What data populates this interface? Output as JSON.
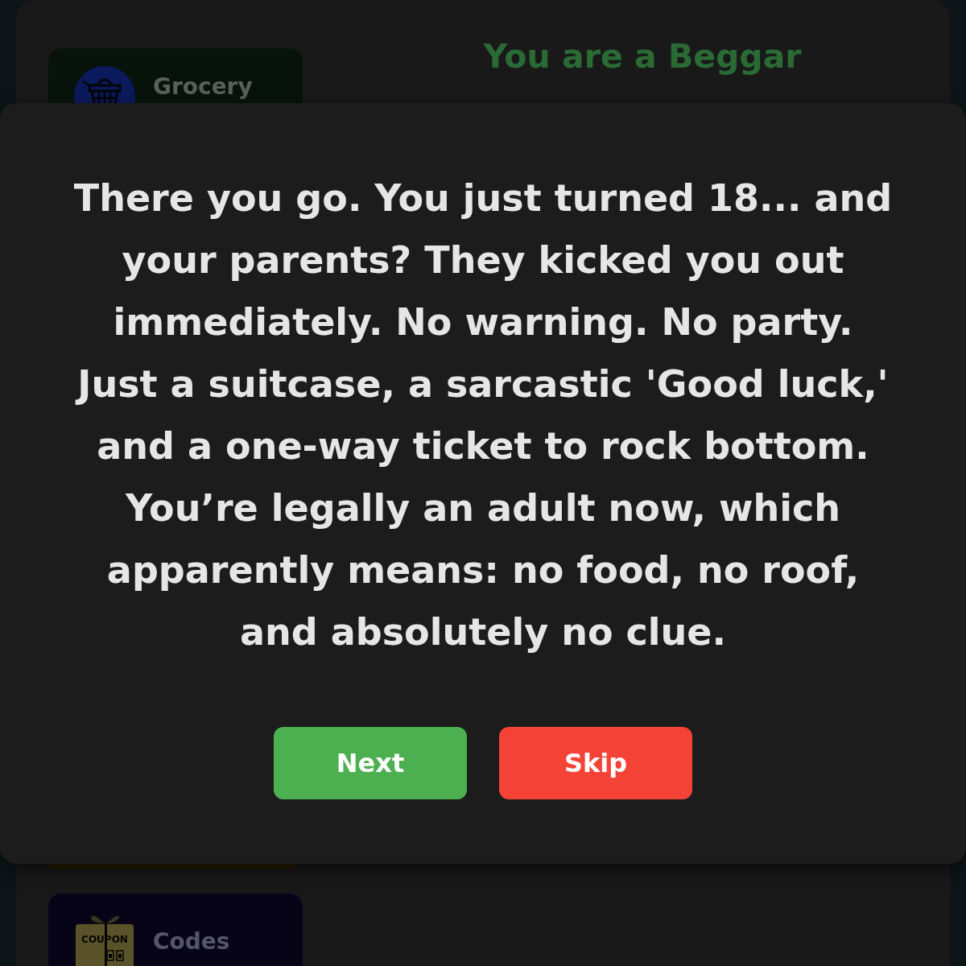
{
  "page": {
    "title": "You are a Beggar",
    "cards": [
      {
        "kind": "grocery",
        "label": "Grocery",
        "color": "#07130a"
      },
      {
        "kind": "edge",
        "color": "#231c02"
      },
      {
        "kind": "coupon",
        "label": "Codes",
        "icon_text": "COUPON",
        "color": "#080417"
      }
    ]
  },
  "dialog": {
    "message": "There you go. You just turned 18... and your parents? They kicked you out immediately. No warning. No party. Just a suitcase, a sarcastic 'Good luck,' and a one-way ticket to rock bottom. You’re legally an adult now, which apparently means: no food, no roof, and absolutely no clue.",
    "buttons": [
      {
        "label": "Next",
        "kind": "primary"
      },
      {
        "label": "Skip",
        "kind": "danger"
      }
    ]
  }
}
